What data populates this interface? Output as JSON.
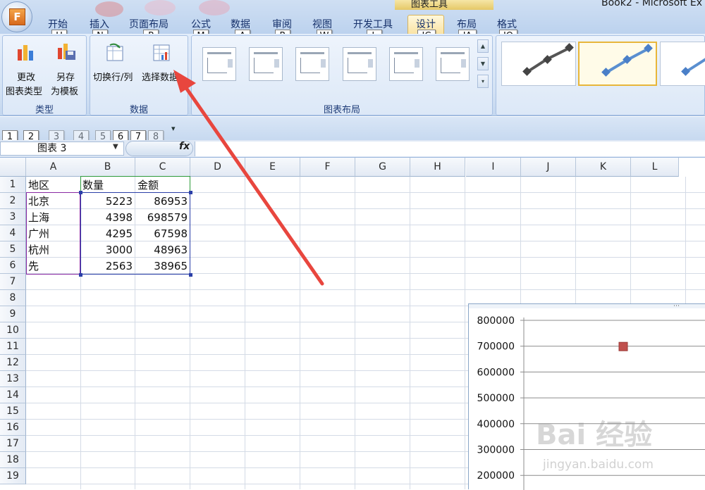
{
  "window": {
    "title": "Book2 - Microsoft Ex",
    "office_logo": "F",
    "context_group": "图表工具"
  },
  "tabs": [
    {
      "label": "开始",
      "key": "H"
    },
    {
      "label": "插入",
      "key": "N"
    },
    {
      "label": "页面布局",
      "key": "P"
    },
    {
      "label": "公式",
      "key": "M"
    },
    {
      "label": "数据",
      "key": "A"
    },
    {
      "label": "审阅",
      "key": "R"
    },
    {
      "label": "视图",
      "key": "W"
    },
    {
      "label": "开发工具",
      "key": "L"
    },
    {
      "label": "设计",
      "key": "JC",
      "active": true
    },
    {
      "label": "布局",
      "key": "JA"
    },
    {
      "label": "格式",
      "key": "JO"
    }
  ],
  "ribbon": {
    "type_group": {
      "label": "类型",
      "change_type": [
        "更改",
        "图表类型"
      ],
      "save_template": [
        "另存",
        "为模板"
      ]
    },
    "data_group": {
      "label": "数据",
      "switch_row_col": "切换行/列",
      "select_data": "选择数据"
    },
    "layout_group": {
      "label": "图表布局"
    },
    "scroll_arrows": [
      "▲",
      "▼",
      "▾"
    ]
  },
  "qat_keys": [
    "1",
    "2",
    "3",
    "4",
    "5",
    "6",
    "7",
    "8"
  ],
  "qat_menu": "▾",
  "formula_bar": {
    "name_box": "图表 3",
    "dropdown_arrow": "▼",
    "fx": "fx"
  },
  "sheet": {
    "columns": [
      "A",
      "B",
      "C",
      "D",
      "E",
      "F",
      "G",
      "H",
      "I",
      "J",
      "K",
      "L"
    ],
    "rows": [
      "1",
      "2",
      "3",
      "4",
      "5",
      "6",
      "7",
      "8",
      "9",
      "10",
      "11",
      "12",
      "13",
      "14",
      "15",
      "16",
      "17",
      "18",
      "19"
    ],
    "header": [
      "地区",
      "数量",
      "金额"
    ],
    "data": [
      [
        "北京",
        "5223",
        "86953"
      ],
      [
        "上海",
        "4398",
        "698579"
      ],
      [
        "广州",
        "4295",
        "67598"
      ],
      [
        "杭州",
        "3000",
        "48963"
      ],
      [
        "先",
        "2563",
        "38965"
      ]
    ]
  },
  "chart_data": {
    "type": "scatter",
    "y_ticks": [
      "800000",
      "700000",
      "600000",
      "500000",
      "400000",
      "300000",
      "200000"
    ],
    "ylim": [
      200000,
      800000
    ],
    "points": [
      {
        "y": 698579
      }
    ],
    "marker_color": "#c0504d",
    "grid": true
  },
  "watermark": {
    "text": "Bai 经验",
    "url": "jingyan.baidu.com"
  },
  "colors": {
    "accent_arrow": "#e8463e",
    "active_tab": "#f9e2a2",
    "ribbon": "#d3e2f4"
  }
}
